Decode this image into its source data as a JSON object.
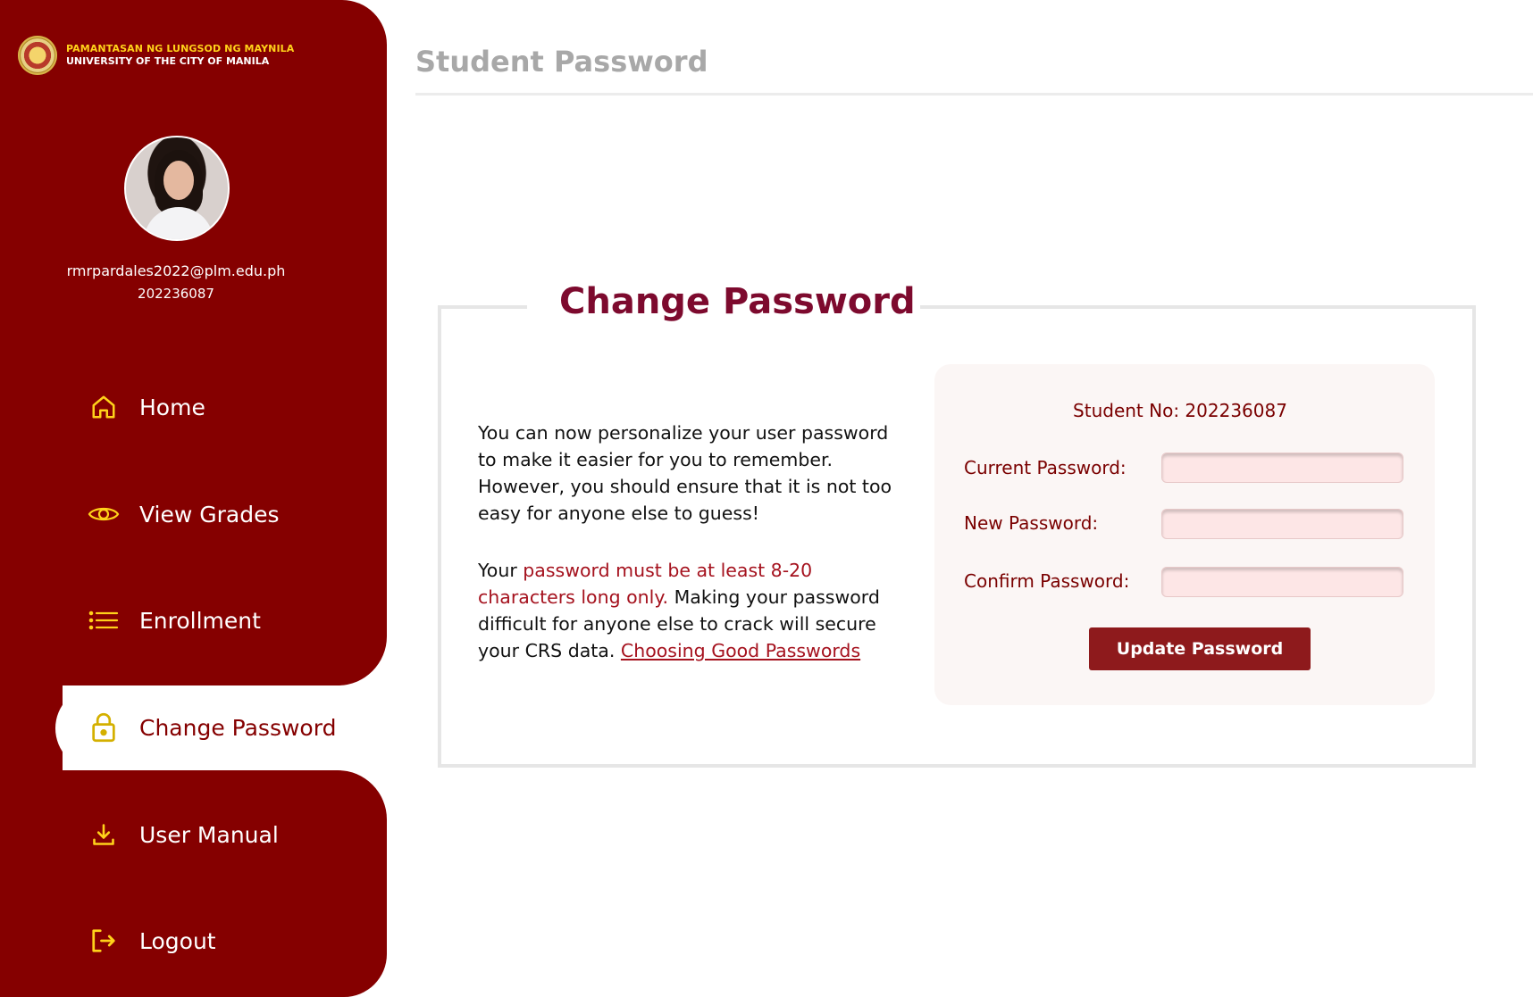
{
  "page": {
    "title": "Student Password"
  },
  "sidebar": {
    "logo_line1": "PAMANTASAN NG LUNGSOD NG MAYNILA",
    "logo_line2": "UNIVERSITY OF THE CITY OF MANILA",
    "user_email": "rmrpardales2022@plm.edu.ph",
    "user_id": "202236087",
    "items": [
      {
        "label": "Home",
        "icon": "home-icon",
        "active": false
      },
      {
        "label": "View Grades",
        "icon": "eye-icon",
        "active": false
      },
      {
        "label": "Enrollment",
        "icon": "list-icon",
        "active": false
      },
      {
        "label": "Change Password",
        "icon": "lock-icon",
        "active": true
      },
      {
        "label": "User Manual",
        "icon": "download-icon",
        "active": false
      },
      {
        "label": "Logout",
        "icon": "logout-icon",
        "active": false
      }
    ]
  },
  "card": {
    "title": "Change Password",
    "para1": "You can now personalize your user password to make it easier for you to remember. However, you should ensure that it is not too easy for anyone else to guess!",
    "para2_prefix": "Your ",
    "para2_highlight": "password must be at least 8-20 characters long only.",
    "para2_suffix": " Making your password difficult for anyone else to crack will secure your CRS data. ",
    "para2_link": "Choosing Good Passwords"
  },
  "form": {
    "student_no": "Student No: 202236087",
    "current_label": "Current Password:",
    "new_label": "New Password:",
    "confirm_label": "Confirm Password:",
    "current_value": "",
    "new_value": "",
    "confirm_value": "",
    "submit_label": "Update Password"
  },
  "colors": {
    "sidebar_bg": "#850000",
    "accent_gold": "#ffd21a",
    "title_maroon": "#7d0a2e",
    "button_bg": "#8e1a1c",
    "input_bg": "#fde6e6"
  }
}
